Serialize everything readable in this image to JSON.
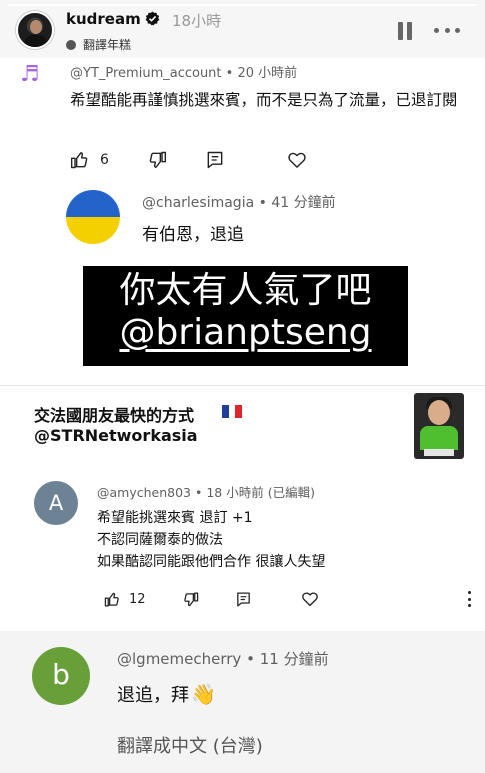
{
  "story": {
    "username": "kudream",
    "time": "18小時",
    "translate_label": "翻譯年糕",
    "progress": 1.0
  },
  "comment1": {
    "handle": "@YT_Premium_account",
    "time": "20 小時前",
    "text": "希望酷能再謹慎挑選來賓，而不是只為了流量，已退訂閱",
    "likes": "6"
  },
  "comment2": {
    "handle": "@charlesimagia",
    "time": "41 分鐘前",
    "text": "有伯恩，退追"
  },
  "caption": {
    "line1": "你太有人氣了吧",
    "line2": "@brianptseng"
  },
  "ad": {
    "title": "交法國朋友最快的方式",
    "handle": "@STRNetworkasia",
    "flag_colors": [
      "#1f3f99",
      "#ffffff",
      "#e0262c"
    ]
  },
  "comment3": {
    "avatar_letter": "A",
    "handle": "@amychen803",
    "time": "18 小時前 (已編輯)",
    "lines": [
      "希望能挑選來賓 退訂 +1",
      "不認同薩爾泰的做法",
      "如果酷認同能跟他們合作 很讓人失望"
    ],
    "likes": "12"
  },
  "comment4": {
    "avatar_letter": "b",
    "handle": "@lgmemecherry",
    "time": "11 分鐘前",
    "text": "退追，拜",
    "emoji": "👋",
    "translate_link": "翻譯成中文 (台灣)"
  },
  "icons": {
    "like": "thumbs-up-icon",
    "dislike": "thumbs-down-icon",
    "reply": "reply-icon",
    "heart": "heart-icon",
    "music": "music-note-icon"
  }
}
